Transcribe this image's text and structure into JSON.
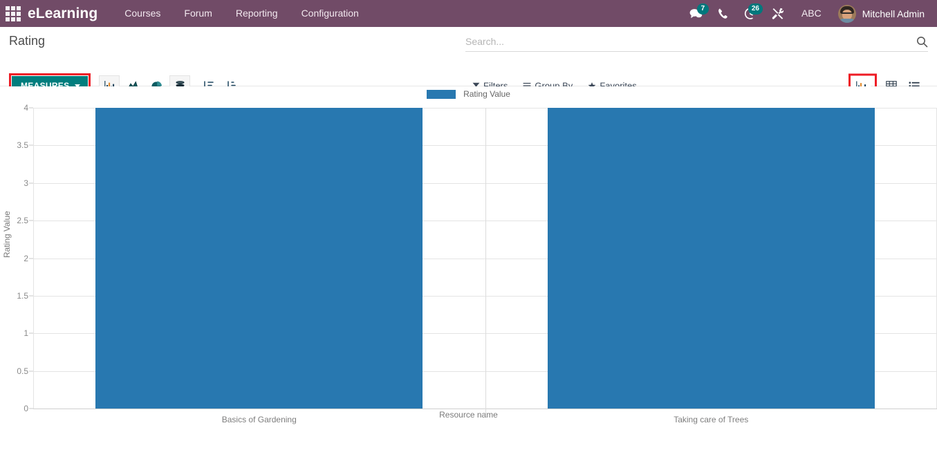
{
  "navbar": {
    "apps_icon": "apps-grid-icon",
    "brand": "eLearning",
    "menu": [
      {
        "label": "Courses"
      },
      {
        "label": "Forum"
      },
      {
        "label": "Reporting"
      },
      {
        "label": "Configuration"
      }
    ],
    "systray": {
      "messages_icon": "messages-icon",
      "messages_count": "7",
      "phone_icon": "phone-icon",
      "activities_icon": "activity-clock-icon",
      "activities_count": "26",
      "tools_icon": "tools-icon",
      "abc_label": "ABC"
    },
    "user": {
      "avatar_icon": "user-avatar",
      "name": "Mitchell Admin"
    }
  },
  "control_panel": {
    "breadcrumb": "Rating",
    "measures_label": "MEASURES",
    "chart_buttons": [
      {
        "name": "bar-chart-icon",
        "active": true
      },
      {
        "name": "line-chart-icon",
        "active": false
      },
      {
        "name": "pie-chart-icon",
        "active": false
      },
      {
        "name": "stacked-icon",
        "active": true
      },
      {
        "name": "sort-descending-icon",
        "active": false
      },
      {
        "name": "sort-ascending-icon",
        "active": false
      }
    ],
    "search": {
      "value": "",
      "placeholder": "Search...",
      "icon": "search-icon"
    },
    "filters": [
      {
        "label": "Filters",
        "icon": "filter-icon"
      },
      {
        "label": "Group By",
        "icon": "group-by-icon"
      },
      {
        "label": "Favorites",
        "icon": "star-icon"
      }
    ],
    "views": [
      {
        "name": "graph-view-icon",
        "active": true
      },
      {
        "name": "pivot-view-icon",
        "active": false
      },
      {
        "name": "list-view-icon",
        "active": false
      }
    ],
    "highlight_color": "#ee1c25",
    "measures_color": "#017e7e"
  },
  "chart_data": {
    "type": "bar",
    "title": "",
    "categories": [
      "Basics of Gardening",
      "Taking care of Trees"
    ],
    "values": [
      4,
      4
    ],
    "series": [
      {
        "name": "Rating Value",
        "values": [
          4,
          4
        ],
        "color": "#2878b0"
      }
    ],
    "legend": [
      {
        "label": "Rating Value",
        "color": "#2878b0"
      }
    ],
    "legend_position": "top",
    "xlabel": "Resource name",
    "ylabel": "Rating Value",
    "ylim": [
      0,
      4
    ],
    "yticks": [
      "0",
      "0.5",
      "1",
      "1.5",
      "2",
      "2.5",
      "3",
      "3.5",
      "4"
    ],
    "ytick_values": [
      0,
      0.5,
      1,
      1.5,
      2,
      2.5,
      3,
      3.5,
      4
    ],
    "grid": true
  }
}
